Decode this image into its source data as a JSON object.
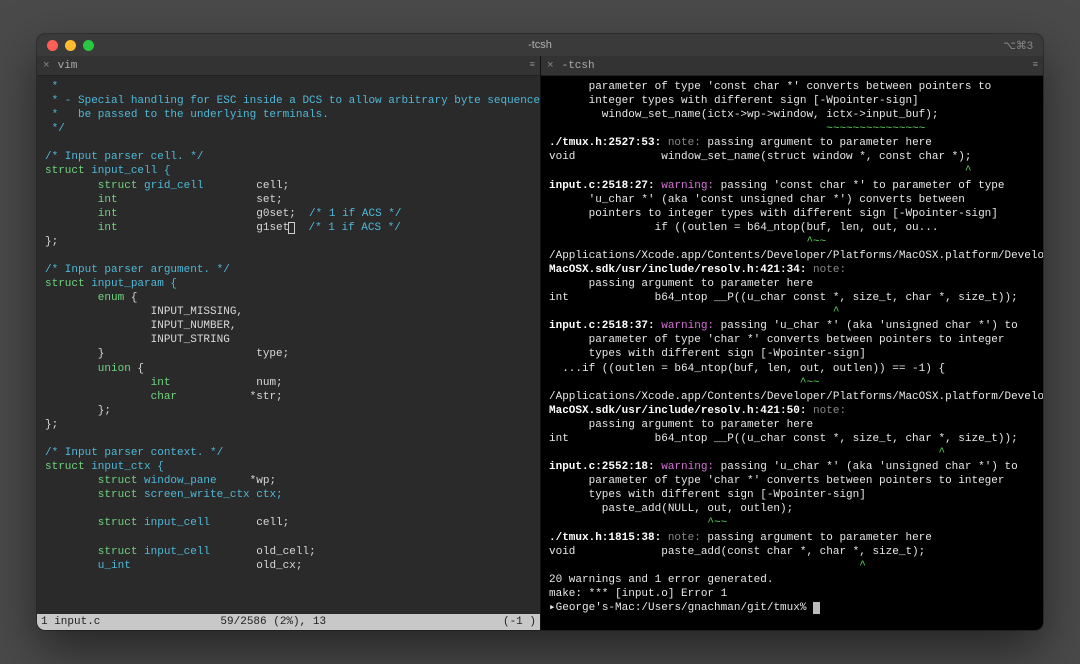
{
  "window": {
    "title": "-tcsh",
    "shortcut": "⌥⌘3"
  },
  "leftTab": {
    "name": "vim",
    "close": "×"
  },
  "rightTab": {
    "name": "-tcsh",
    "close": "×"
  },
  "status": {
    "left": "1 input.c",
    "mid": "59/2586 (2%), 13",
    "right": "(-1 )"
  },
  "vim": {
    "l1": " *",
    "l2a": " * - Special handling for ESC inside a DCS to allow arbitrary byte sequences to",
    "l2b": " *   be passed to the underlying terminals.",
    "l3": " */",
    "blank": "",
    "c1": "/* Input parser cell. */",
    "s1a": "struct",
    "s1b": " input_cell {",
    "f1a": "        struct",
    "f1b": " grid_cell",
    "f1c": "        cell;",
    "f2a": "        int",
    "f2b": "                     set;",
    "f3a": "        int",
    "f3b": "                     g0set;",
    "f3c": "  /* 1 if ACS */",
    "f4a": "        int",
    "f4b": "                     g1set",
    "f4cur": "",
    "f4c": "  /* 1 if ACS */",
    "s1e": "};",
    "c2": "/* Input parser argument. */",
    "s2a": "struct",
    "s2b": " input_param {",
    "e1": "        enum",
    "e1b": " {",
    "e2": "                INPUT_MISSING,",
    "e3": "                INPUT_NUMBER,",
    "e4": "                INPUT_STRING",
    "e5": "        }                       type;",
    "u1": "        union",
    "u1b": " {",
    "u2a": "                int",
    "u2b": "             num;",
    "u3a": "                char",
    "u3b": "           *str;",
    "u4": "        };",
    "s2e": "};",
    "c3": "/* Input parser context. */",
    "s3a": "struct",
    "s3b": " input_ctx {",
    "x1a": "        struct",
    "x1b": " window_pane",
    "x1c": "     *wp;",
    "x2a": "        struct",
    "x2b": " screen_write_ctx ctx;",
    "x3a": "        struct",
    "x3b": " input_cell",
    "x3c": "       cell;",
    "x4a": "        struct",
    "x4b": " input_cell",
    "x4c": "       old_cell;",
    "x5a": "        u_int",
    "x5b": "                   old_cx;"
  },
  "term": {
    "l1": "      parameter of type 'const char *' converts between pointers to",
    "l2": "      integer types with different sign [-Wpointer-sign]",
    "l3": "        window_set_name(ictx->wp->window, ictx->input_buf);",
    "l3c": "                                          ~~~~~~~~~~~~~~~",
    "l4a": "./tmux.h:2527:53:",
    "l4b": " note:",
    "l4c": " passing argument to parameter here",
    "l5": "void             window_set_name(struct window *, const char *);",
    "l5c": "                                                               ^",
    "l6a": "input.c:2518:27:",
    "l6b": " warning:",
    "l6c": " passing 'const char *' to parameter of type",
    "l7": "      'u_char *' (aka 'const unsigned char *') converts between",
    "l8": "      pointers to integer types with different sign [-Wpointer-sign]",
    "l9": "                if ((outlen = b64_ntop(buf, len, out, ou...",
    "l9c": "                                       ^~~",
    "l10": "/Applications/Xcode.app/Contents/Developer/Platforms/MacOSX.platform/Developer/SDKs/",
    "l11a": "MacOSX.sdk/usr/include/resolv.h:421:34:",
    "l11b": " note:",
    "l12": "      passing argument to parameter here",
    "l13": "int             b64_ntop __P((u_char const *, size_t, char *, size_t));",
    "l13c": "                                           ^",
    "l14a": "input.c:2518:37:",
    "l14b": " warning:",
    "l14c": " passing 'u_char *' (aka 'unsigned char *') to",
    "l15": "      parameter of type 'char *' converts between pointers to integer",
    "l16": "      types with different sign [-Wpointer-sign]",
    "l17": "  ...if ((outlen = b64_ntop(buf, len, out, outlen)) == -1) {",
    "l17c": "                                      ^~~",
    "l18": "/Applications/Xcode.app/Contents/Developer/Platforms/MacOSX.platform/Developer/SDKs/",
    "l19a": "MacOSX.sdk/usr/include/resolv.h:421:50:",
    "l19b": " note:",
    "l20": "      passing argument to parameter here",
    "l21": "int             b64_ntop __P((u_char const *, size_t, char *, size_t));",
    "l21c": "                                                           ^",
    "l22a": "input.c:2552:18:",
    "l22b": " warning:",
    "l22c": " passing 'u_char *' (aka 'unsigned char *') to",
    "l23": "      parameter of type 'char *' converts between pointers to integer",
    "l24": "      types with different sign [-Wpointer-sign]",
    "l25": "        paste_add(NULL, out, outlen);",
    "l25c": "                        ^~~",
    "l26a": "./tmux.h:1815:38:",
    "l26b": " note:",
    "l26c": " passing argument to parameter here",
    "l27": "void             paste_add(const char *, char *, size_t);",
    "l27c": "                                               ^",
    "l28": "20 warnings and 1 error generated.",
    "l29": "make: *** [input.o] Error 1",
    "prompt": "▸George's-Mac:/Users/gnachman/git/tmux% "
  }
}
